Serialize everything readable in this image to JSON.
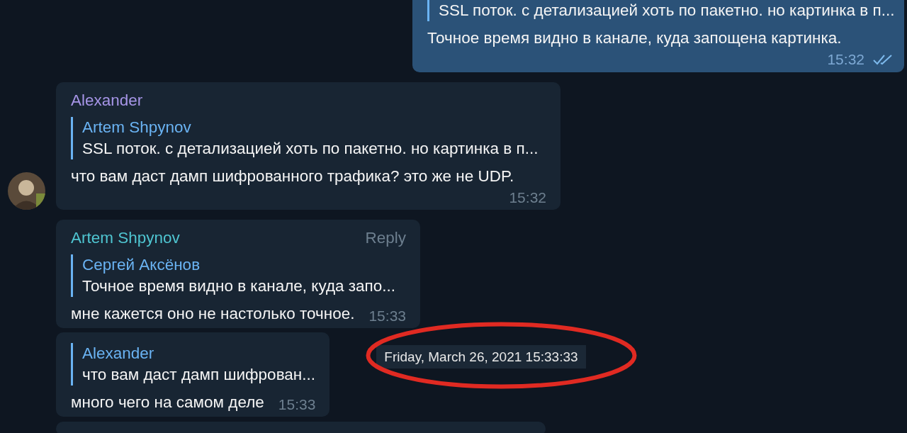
{
  "messages": [
    {
      "kind": "outgoing",
      "reply": {
        "text": "SSL поток. с детализацией хоть по пакетно. но картинка в п..."
      },
      "text": "Точное время видно в канале, куда запощена картинка.",
      "time": "15:32",
      "read": true
    },
    {
      "kind": "incoming",
      "sender": "Alexander",
      "color": "#a695e7",
      "avatar": true,
      "reply": {
        "sender": "Artem Shpynov",
        "text": "SSL поток. с детализацией хоть по пакетно. но картинка в п..."
      },
      "text": "что вам даст дамп шифрованного трафика? это же не UDP.",
      "time": "15:32"
    },
    {
      "kind": "incoming",
      "sender": "Artem Shpynov",
      "color": "#4fc5d1",
      "action": "Reply",
      "avatar": false,
      "reply": {
        "sender": "Сергей Аксёнов",
        "text": "Точное время видно в канале, куда запо..."
      },
      "text": "мне кажется оно не настолько точное.",
      "time": "15:33"
    },
    {
      "kind": "incoming",
      "avatar": false,
      "reply": {
        "sender": "Alexander",
        "text": "что вам даст дамп шифрован..."
      },
      "text": "много чего на самом деле",
      "time": "15:33",
      "tooltip": {
        "text": "Friday, March 26, 2021 15:33:33",
        "highlighted": true
      }
    },
    {
      "kind": "clipped"
    }
  ]
}
